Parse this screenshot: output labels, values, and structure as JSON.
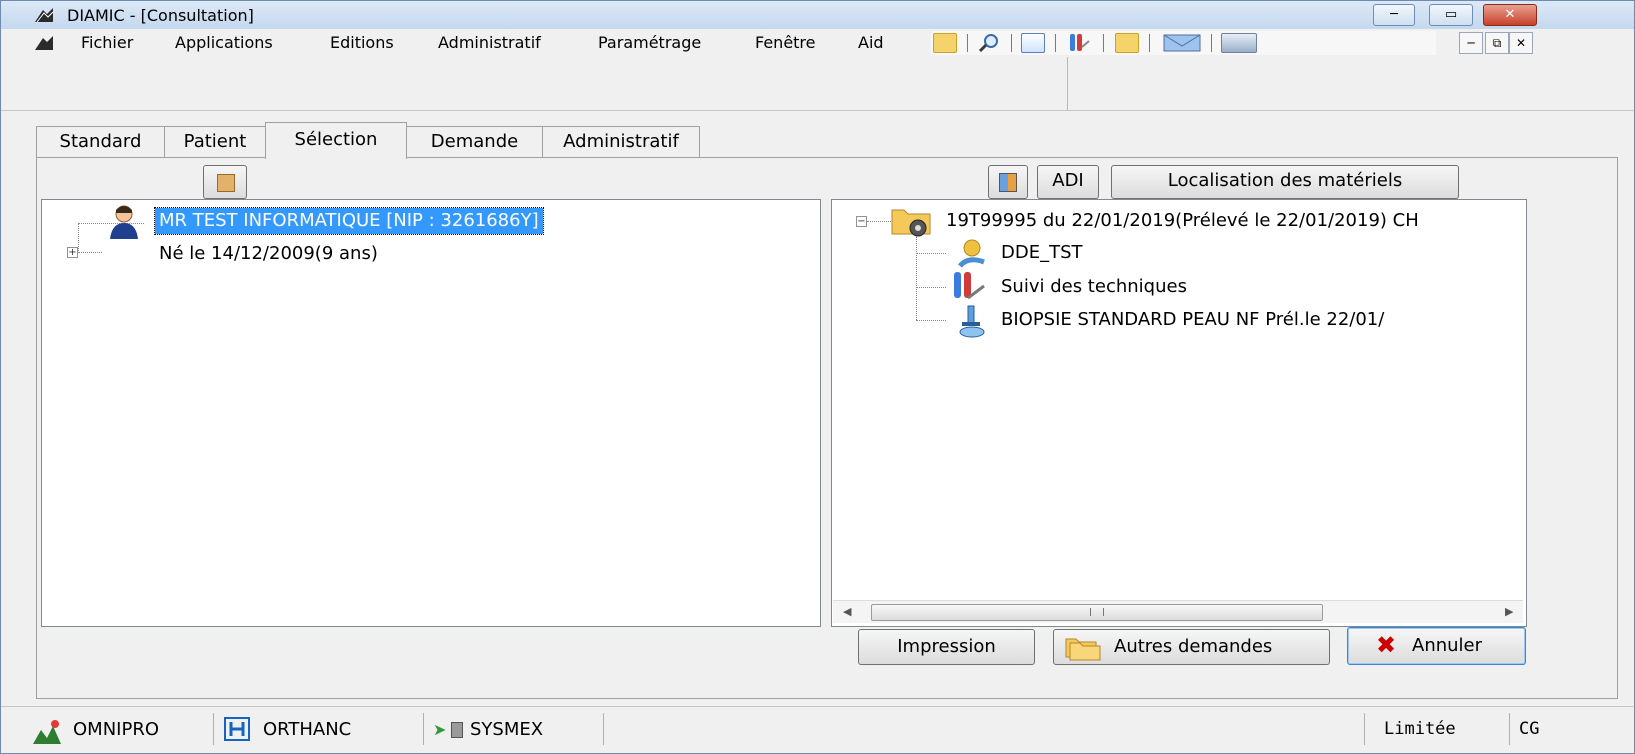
{
  "window": {
    "title": "DIAMIC - [Consultation]"
  },
  "menu": {
    "items": [
      "Fichier",
      "Applications",
      "Editions",
      "Administratif",
      "Paramétrage",
      "Fenêtre",
      "Aid"
    ]
  },
  "toolbar": {
    "icons": [
      "folder-icon",
      "magnifier-icon",
      "edit-document-icon",
      "test-tubes-icon",
      "folder-export-icon",
      "envelope-icon",
      "scanner-icon"
    ]
  },
  "tabs": {
    "items": [
      "Standard",
      "Patient",
      "Sélection",
      "Demande",
      "Administratif"
    ],
    "active": "Sélection"
  },
  "left_tree": {
    "patient_label": "MR TEST INFORMATIQUE [NIP : 3261686Y]",
    "birth_label": "Né le 14/12/2009(9 ans)"
  },
  "right_panel": {
    "adi_label": "ADI",
    "localisation_label": "Localisation des matériels",
    "tree": {
      "root": "19T99995 du 22/01/2019(Prélevé le 22/01/2019) CH",
      "children": [
        "DDE_TST",
        "Suivi des techniques",
        "BIOPSIE STANDARD PEAU NF Prél.le 22/01/"
      ]
    }
  },
  "buttons": {
    "impression": "Impression",
    "autres_demandes": "Autres demandes",
    "annuler": "Annuler"
  },
  "statusbar": {
    "items": [
      "OMNIPRO",
      "ORTHANC",
      "SYSMEX"
    ],
    "mode": "Limitée",
    "user": "CG"
  },
  "colors": {
    "selection": "#3399ff",
    "frame": "#b9d1ea",
    "cancel_icon": "#cc0000"
  }
}
